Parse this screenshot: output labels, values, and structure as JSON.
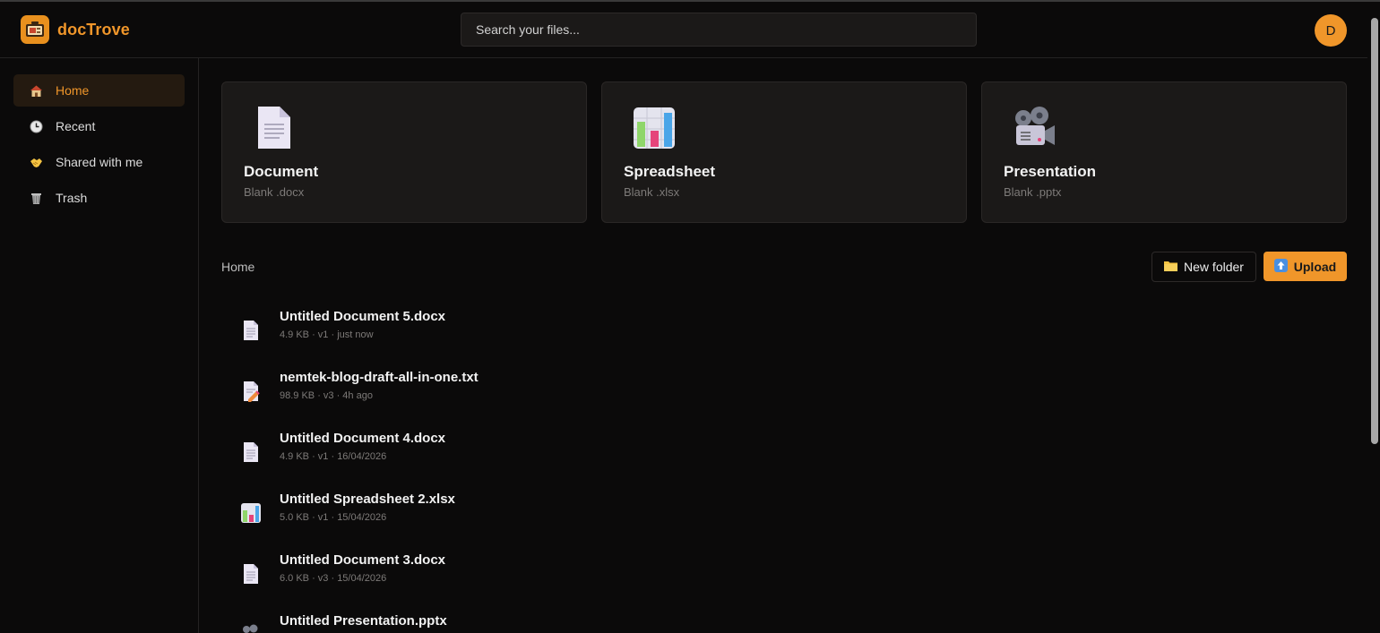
{
  "app": {
    "name": "docTrove",
    "accent": "#f0962a"
  },
  "header": {
    "search_placeholder": "Search your files...",
    "avatar_initial": "D"
  },
  "sidebar": {
    "items": [
      {
        "label": "Home",
        "icon": "house-icon",
        "active": true
      },
      {
        "label": "Recent",
        "icon": "clock-icon",
        "active": false
      },
      {
        "label": "Shared with me",
        "icon": "handshake-icon",
        "active": false
      },
      {
        "label": "Trash",
        "icon": "wastebasket-icon",
        "active": false
      }
    ]
  },
  "new_cards": [
    {
      "title": "Document",
      "subtitle": "Blank .docx",
      "icon": "document-icon"
    },
    {
      "title": "Spreadsheet",
      "subtitle": "Blank .xlsx",
      "icon": "bar-chart-icon"
    },
    {
      "title": "Presentation",
      "subtitle": "Blank .pptx",
      "icon": "film-projector-icon"
    }
  ],
  "breadcrumb": "Home",
  "actions": {
    "new_folder": "New folder",
    "upload": "Upload"
  },
  "files": [
    {
      "name": "Untitled Document 5.docx",
      "meta": "4.9 KB · v1 · just now",
      "icon": "document-icon"
    },
    {
      "name": "nemtek-blog-draft-all-in-one.txt",
      "meta": "98.9 KB · v3 · 4h ago",
      "icon": "memo-icon"
    },
    {
      "name": "Untitled Document 4.docx",
      "meta": "4.9 KB · v1 · 16/04/2026",
      "icon": "document-icon"
    },
    {
      "name": "Untitled Spreadsheet 2.xlsx",
      "meta": "5.0 KB · v1 · 15/04/2026",
      "icon": "bar-chart-icon"
    },
    {
      "name": "Untitled Document 3.docx",
      "meta": "6.0 KB · v3 · 15/04/2026",
      "icon": "document-icon"
    },
    {
      "name": "Untitled Presentation.pptx",
      "meta": "",
      "icon": "film-projector-icon"
    }
  ]
}
